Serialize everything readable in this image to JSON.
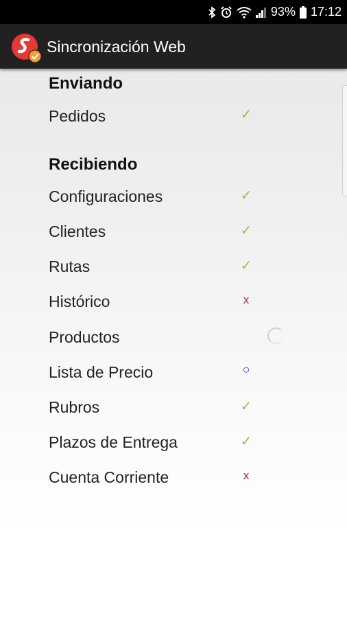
{
  "status_bar": {
    "battery_percent": "93%",
    "time": "17:12",
    "icons": [
      "bluetooth-icon",
      "alarm-icon",
      "wifi-icon",
      "signal-icon",
      "battery-icon"
    ]
  },
  "app_bar": {
    "title": "Sincronización Web",
    "logo_icon": "app-logo-icon",
    "colors": {
      "background": "#212121",
      "logo_red": "#e53935",
      "logo_badge": "#f39c34"
    }
  },
  "sections": [
    {
      "title": "Enviando",
      "items": [
        {
          "label": "Pedidos",
          "status": "ok"
        }
      ]
    },
    {
      "title": "Recibiendo",
      "items": [
        {
          "label": "Configuraciones",
          "status": "ok"
        },
        {
          "label": "Clientes",
          "status": "ok"
        },
        {
          "label": "Rutas",
          "status": "ok"
        },
        {
          "label": "Histórico",
          "status": "error"
        },
        {
          "label": "Productos",
          "status": "loading"
        },
        {
          "label": "Lista de Precio",
          "status": "pending"
        },
        {
          "label": "Rubros",
          "status": "ok"
        },
        {
          "label": "Plazos de Entrega",
          "status": "ok"
        },
        {
          "label": "Cuenta Corriente",
          "status": "error"
        }
      ]
    }
  ],
  "status_glyphs": {
    "ok": "✓",
    "error": "x",
    "pending": "○"
  },
  "status_colors": {
    "ok": "#8bc34a",
    "error": "#b0242a",
    "pending": "#1e35c8"
  }
}
